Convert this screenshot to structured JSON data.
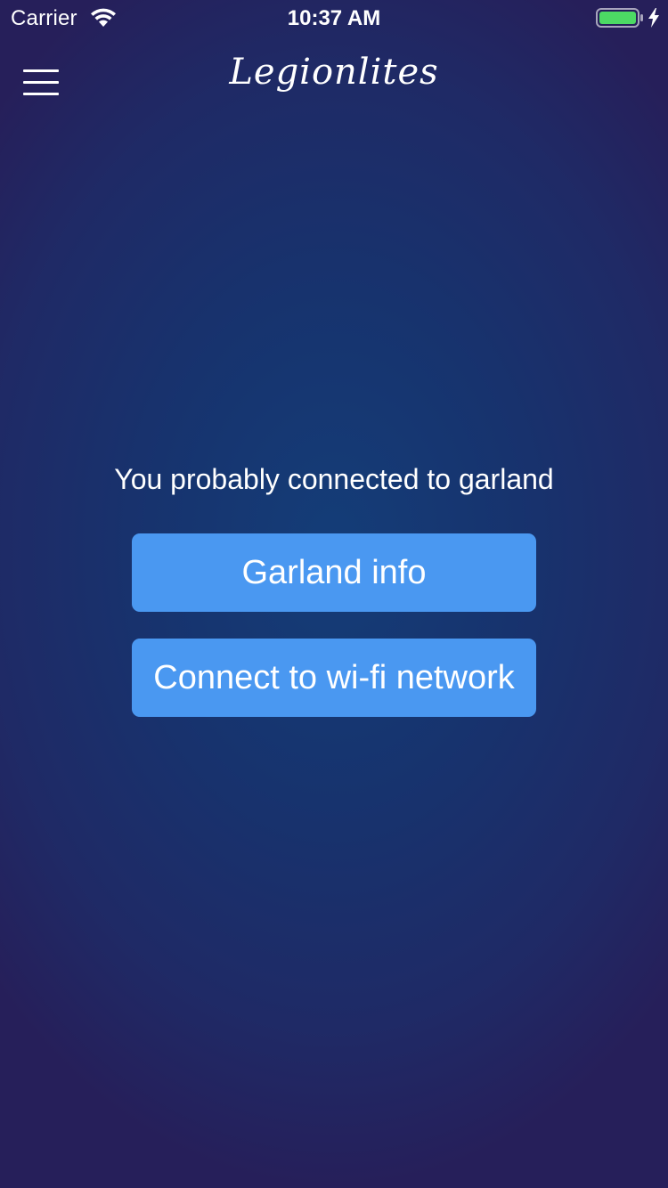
{
  "status_bar": {
    "carrier": "Carrier",
    "time": "10:37 AM",
    "wifi_icon": "wifi-icon",
    "battery_icon": "battery-icon",
    "battery_color": "#4cd964",
    "charging_icon": "bolt-icon"
  },
  "nav": {
    "menu_icon": "hamburger-menu-icon",
    "logo_text": "Legionlites"
  },
  "main": {
    "message": "You probably connected to garland",
    "buttons": [
      {
        "label": "Garland info"
      },
      {
        "label": "Connect to wi-fi network"
      }
    ]
  },
  "colors": {
    "background": "#17336e",
    "button": "#4a98f1",
    "text": "#ffffff"
  }
}
